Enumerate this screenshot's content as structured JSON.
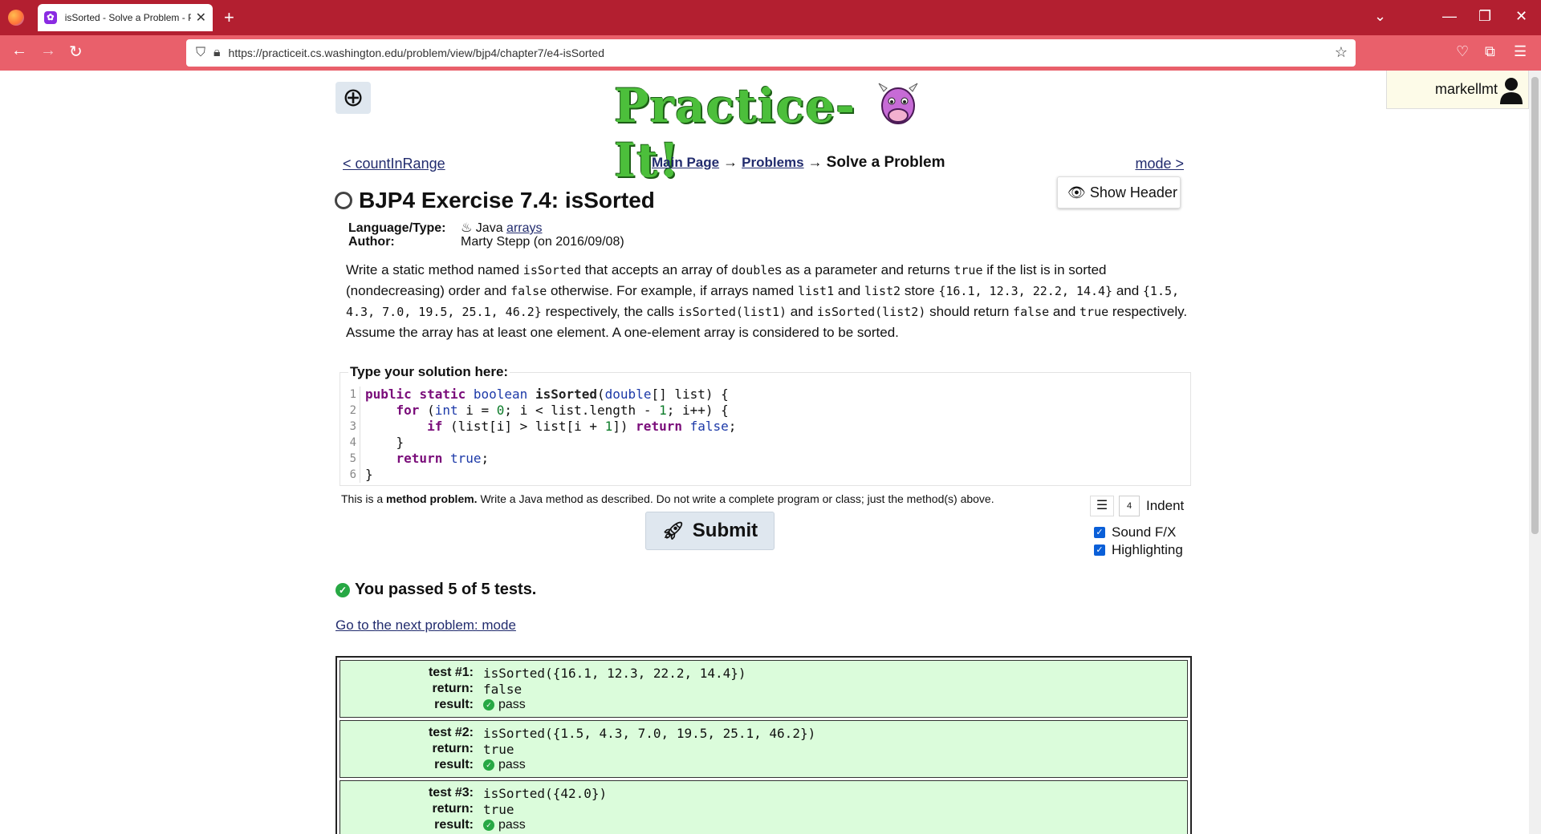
{
  "browser": {
    "tab_title": "isSorted - Solve a Problem - Pra",
    "url": "https://practiceit.cs.washington.edu/problem/view/bjp4/chapter7/e4-isSorted"
  },
  "user": {
    "name": "markellmt"
  },
  "logo": {
    "text": "Practice-It!"
  },
  "nav": {
    "prev": "< countInRange",
    "main_page": "Main Page",
    "arrow1": "→",
    "problems": "Problems",
    "arrow2": "→",
    "current": "Solve a Problem",
    "next": "mode >"
  },
  "show_header": "Show Header",
  "problem": {
    "title": "BJP4 Exercise 7.4: isSorted",
    "language_label": "Language/Type:",
    "language": "Java",
    "type_link": "arrays",
    "author_label": "Author:",
    "author": "Marty Stepp (on 2016/09/08)"
  },
  "description": {
    "p1": "Write a static method named ",
    "c1": "isSorted",
    "p2": " that accepts an array of ",
    "c2": "double",
    "p3": "s as a parameter and returns ",
    "c3": "true",
    "p4": " if the list is in sorted (nondecreasing) order and ",
    "c4": "false",
    "p5": " otherwise. For example, if arrays named ",
    "c5": "list1",
    "p6": " and ",
    "c6": "list2",
    "p7": " store ",
    "c7": "{16.1, 12.3, 22.2, 14.4}",
    "p8": " and ",
    "c8": "{1.5, 4.3, 7.0, 19.5, 25.1, 46.2}",
    "p9": " respectively, the calls ",
    "c9": "isSorted(list1)",
    "p10": " and ",
    "c10": "isSorted(list2)",
    "p11": " should return ",
    "c11": "false",
    "p12": " and ",
    "c12": "true",
    "p13": " respectively. Assume the array has at least one element. A one-element array is considered to be sorted."
  },
  "solution": {
    "label": "Type your solution here:",
    "line_numbers": [
      "1",
      "2",
      "3",
      "4",
      "5",
      "6"
    ]
  },
  "method_note": {
    "prefix": "This is a ",
    "bold": "method problem.",
    "suffix": " Write a Java method as described. Do not write a complete program or class; just the method(s) above."
  },
  "options": {
    "indent_value": "4",
    "indent_label": "Indent",
    "sound_label": "Sound F/X",
    "highlight_label": "Highlighting"
  },
  "submit_label": "Submit",
  "result": {
    "summary": "You passed 5 of 5 tests.",
    "next_link": "Go to the next problem: mode"
  },
  "tests": [
    {
      "label": "test #1:",
      "call": "isSorted({16.1, 12.3, 22.2, 14.4})",
      "return_label": "return:",
      "return": "false",
      "result_label": "result:",
      "result": "pass"
    },
    {
      "label": "test #2:",
      "call": "isSorted({1.5, 4.3, 7.0, 19.5, 25.1, 46.2})",
      "return_label": "return:",
      "return": "true",
      "result_label": "result:",
      "result": "pass"
    },
    {
      "label": "test #3:",
      "call": "isSorted({42.0})",
      "return_label": "return:",
      "return": "true",
      "result_label": "result:",
      "result": "pass"
    }
  ]
}
